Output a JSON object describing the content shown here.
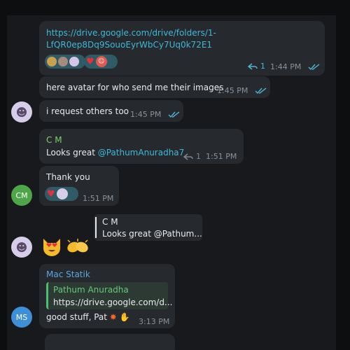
{
  "messages": {
    "m1": {
      "link_line1": "https://drive.google.com/drive/folders/1-",
      "link_line2": "LfQR0ep8Dq9SouoEyrWbCy7Uq0k72E1",
      "forward_count": "1",
      "time": "1:44 PM"
    },
    "m2": {
      "text": "here avatar for who send me their images",
      "time": "1:45 PM"
    },
    "m3": {
      "text": "i request others too",
      "time": "1:45 PM"
    },
    "m4": {
      "sender": "C M",
      "text_prefix": "Looks great ",
      "mention": "@PathumAnuradha7",
      "forward_count": "1",
      "time": "1:51 PM"
    },
    "m5": {
      "text": "Thank you",
      "time": "1:51 PM",
      "avatar_initials": "CM"
    },
    "m6": {
      "quote_sender": "C M",
      "quote_text": "Looks great @Pathum..."
    },
    "m7": {
      "sender": "Mac Statik",
      "reply_sender": "Pathum Anuradha",
      "reply_text": "https://drive.google.com/d...",
      "text": "good stuff, Pat",
      "time": "3:13 PM",
      "avatar_initials": "MS"
    }
  },
  "colors": {
    "background": "#0d0e10",
    "chat_background": "#17191c",
    "bubble": "#262a2f",
    "link": "#3fb8d8",
    "sender_cm": "#7fd16a",
    "sender_mac": "#5aa6e0",
    "reply_sender": "#63c97a",
    "avatar_cm": "#4fa64a",
    "avatar_ms": "#3f8fd8",
    "check": "#4fb8d0"
  },
  "icons": [
    "forward-icon",
    "double-check-icon",
    "heart-icon",
    "avatar-image",
    "heart-eyes-cat-emoji",
    "clapping-hands-emoji",
    "collision-emoji",
    "raised-hands-emoji"
  ]
}
